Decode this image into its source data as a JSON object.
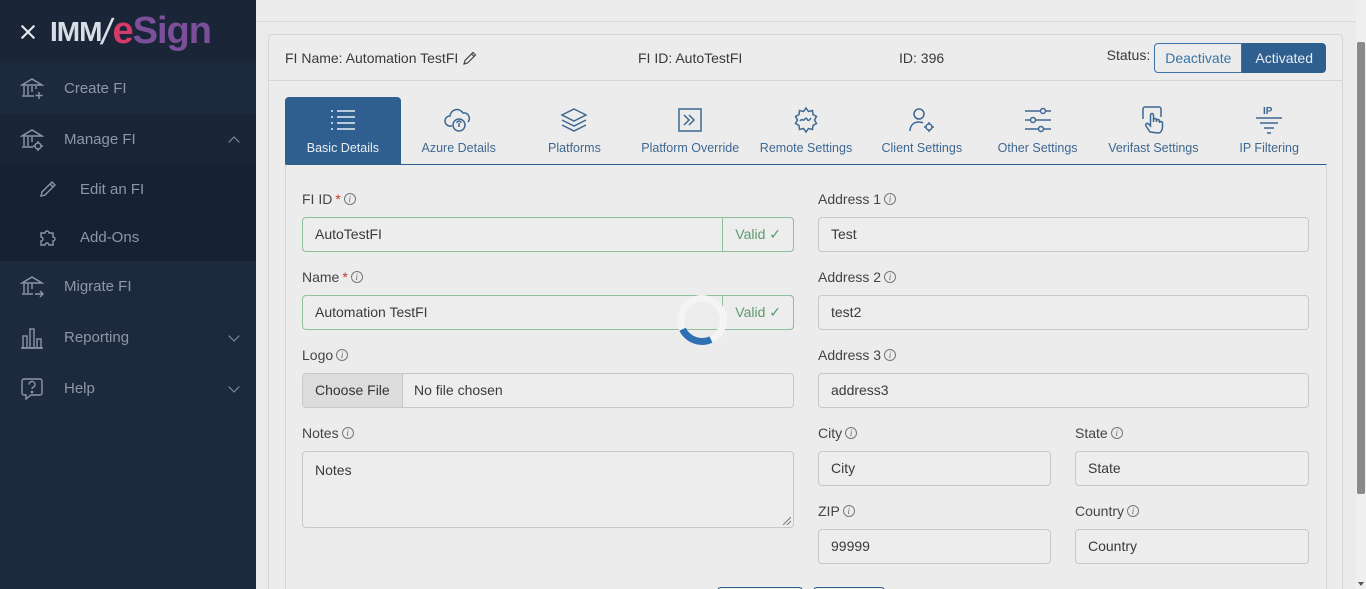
{
  "sidebar": {
    "logo": {
      "imm": "IMM",
      "slash": "/",
      "e": "e",
      "sign": "Sign"
    },
    "items": [
      {
        "label": "Create FI",
        "icon": "bank-plus-icon"
      },
      {
        "label": "Manage FI",
        "icon": "bank-gear-icon"
      },
      {
        "label": "Migrate FI",
        "icon": "bank-arrow-icon"
      },
      {
        "label": "Reporting",
        "icon": "bar-chart-icon"
      },
      {
        "label": "Help",
        "icon": "question-bubble-icon"
      }
    ],
    "subitems": [
      {
        "label": "Edit an FI",
        "icon": "pencil-icon"
      },
      {
        "label": "Add-Ons",
        "icon": "puzzle-icon"
      }
    ]
  },
  "header": {
    "fi_name": "FI Name: Automation TestFI",
    "fi_id": "FI ID: AutoTestFI",
    "id": "ID: 396",
    "status_label": "Status:",
    "deactivate": "Deactivate",
    "activated": "Activated"
  },
  "tabs": [
    {
      "label": "Basic Details",
      "icon": "list-icon",
      "active": true
    },
    {
      "label": "Azure Details",
      "icon": "cloud-lock-icon"
    },
    {
      "label": "Platforms",
      "icon": "layers-icon"
    },
    {
      "label": "Platform Override",
      "icon": "arrow-box-icon"
    },
    {
      "label": "Remote Settings",
      "icon": "gear-wave-icon"
    },
    {
      "label": "Client Settings",
      "icon": "user-gear-icon"
    },
    {
      "label": "Other Settings",
      "icon": "sliders-icon"
    },
    {
      "label": "Verifast Settings",
      "icon": "hand-touch-icon"
    },
    {
      "label": "IP Filtering",
      "icon": "ip-filter-icon"
    }
  ],
  "form": {
    "fi_id": {
      "label": "FI ID",
      "req": "*",
      "value": "AutoTestFI",
      "valid": "Valid ✓"
    },
    "name": {
      "label": "Name",
      "req": "*",
      "value": "Automation TestFI",
      "valid": "Valid ✓"
    },
    "logo": {
      "label": "Logo",
      "button": "Choose File",
      "text": "No file chosen"
    },
    "notes": {
      "label": "Notes",
      "value": "Notes"
    },
    "address1": {
      "label": "Address 1",
      "value": "Test"
    },
    "address2": {
      "label": "Address 2",
      "value": "test2"
    },
    "address3": {
      "label": "Address 3",
      "value": "address3"
    },
    "city": {
      "label": "City",
      "value": "City"
    },
    "state": {
      "label": "State",
      "value": "State"
    },
    "zip": {
      "label": "ZIP",
      "value": "99999"
    },
    "country": {
      "label": "Country",
      "value": "Country"
    }
  },
  "info_glyph": "i",
  "colors": {
    "primary": "#2f5f8e",
    "sidebar": "#1d2a3d",
    "valid": "#5b9a6d",
    "spinner": "#2f6fb3"
  }
}
